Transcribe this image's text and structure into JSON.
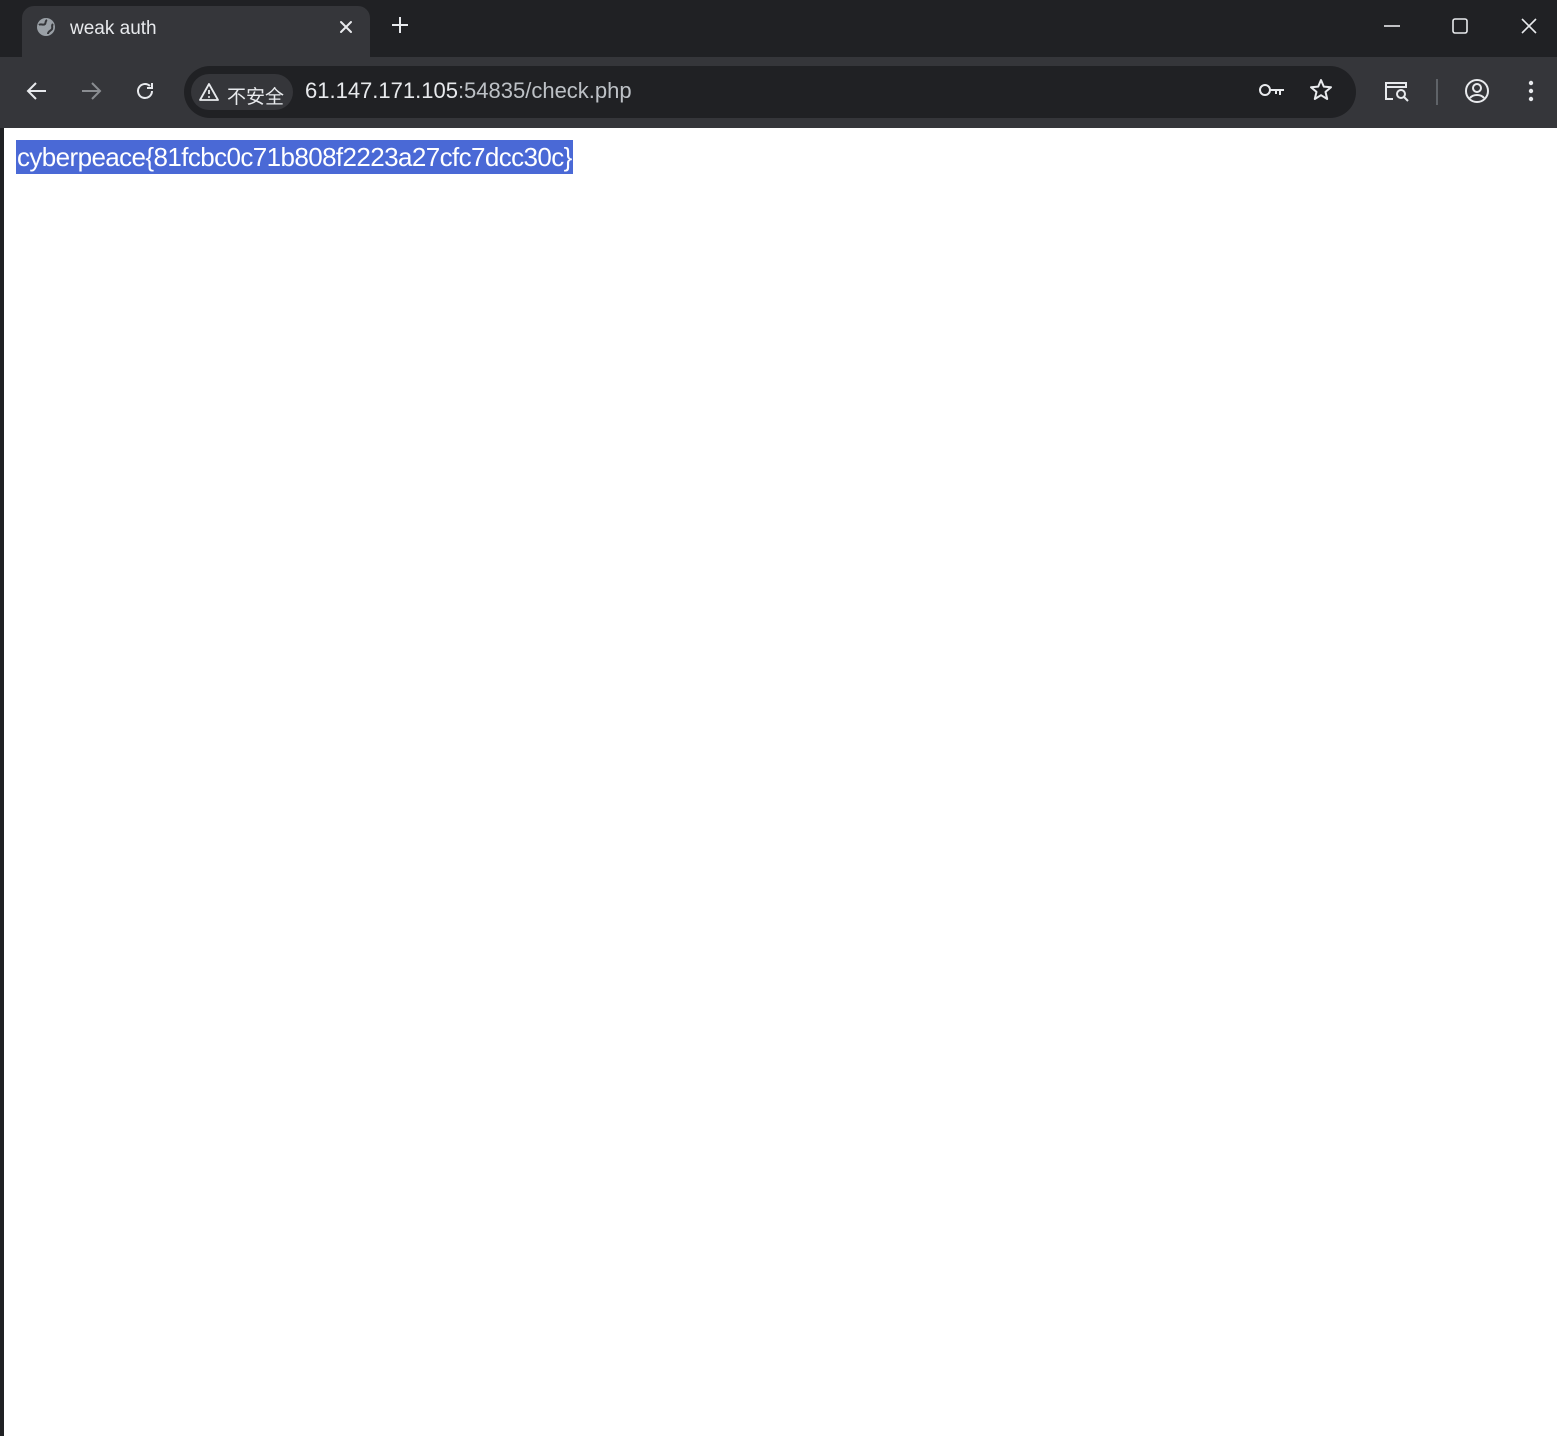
{
  "tab": {
    "title": "weak auth",
    "close_icon": "close-icon",
    "favicon": "globe-icon"
  },
  "new_tab_icon": "plus-icon",
  "window_controls": [
    "minimize-icon",
    "maximize-icon",
    "close-icon"
  ],
  "toolbar": {
    "back_icon": "back-arrow-icon",
    "forward_icon": "forward-arrow-icon",
    "reload_icon": "reload-icon",
    "security_label": "不安全",
    "url_host": "61.147.171.105",
    "url_path": ":54835/check.php",
    "omnibox_icons": [
      "key-icon",
      "star-icon"
    ],
    "right_icons": [
      "tab-search-icon",
      "profile-icon",
      "kebab-menu-icon"
    ]
  },
  "page": {
    "flag_text": "cyberpeace{81fcbc0c71b808f2223a27cfc7dcc30c}",
    "selection_color": "#4a69d6"
  },
  "colors": {
    "frame": "#202124",
    "toolbar": "#35363a",
    "text": "#e8eaed"
  }
}
